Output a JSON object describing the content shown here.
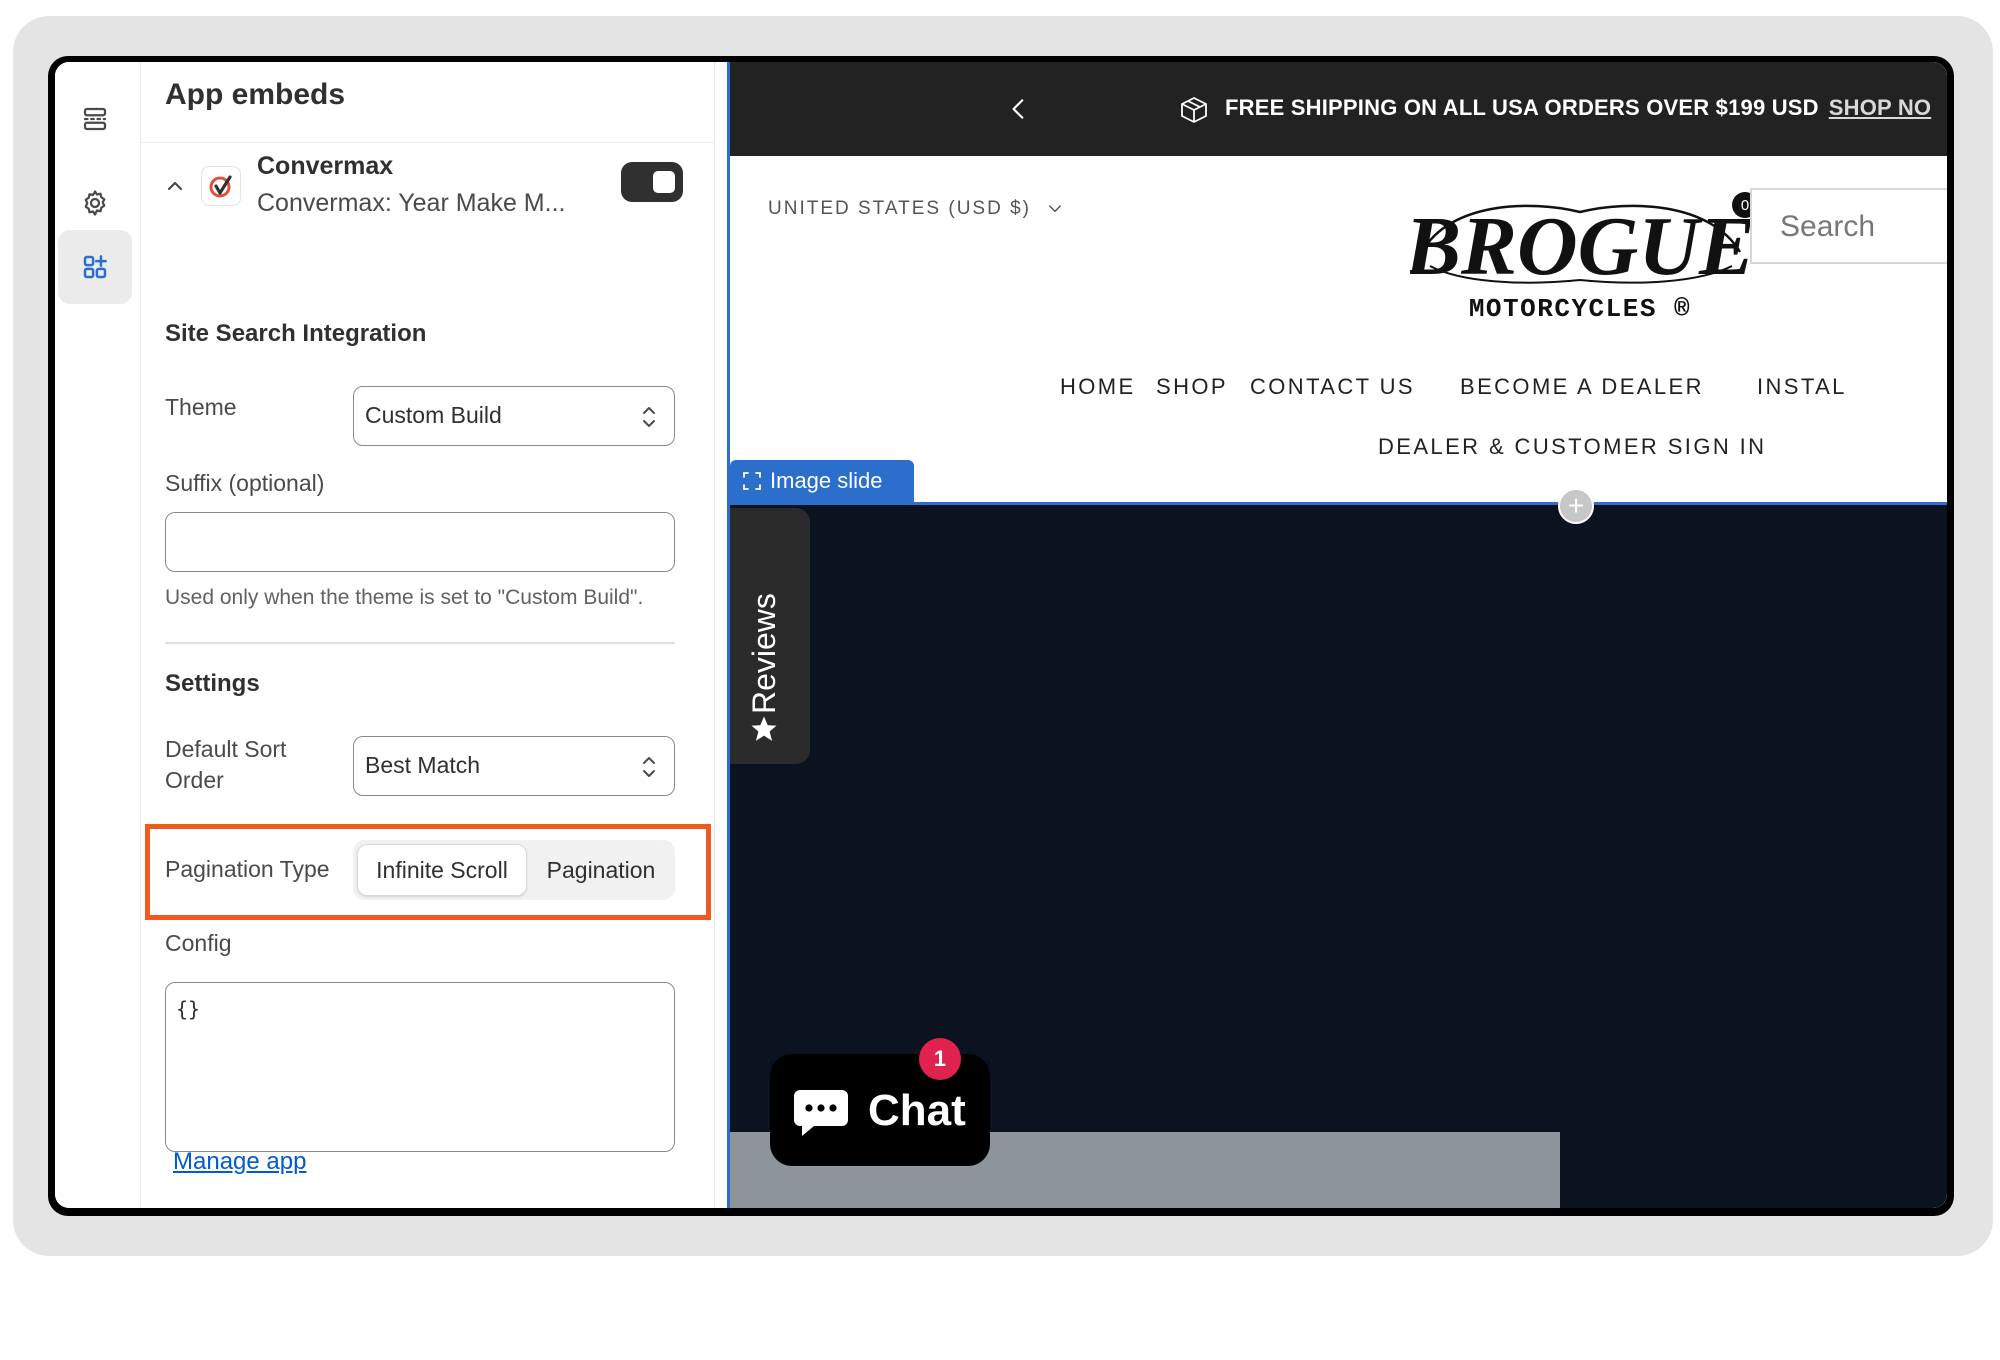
{
  "sidebar": {
    "title": "App embeds",
    "app": {
      "name": "Convermax",
      "subtitle": "Convermax: Year Make M...",
      "enabled": true
    },
    "site_search": {
      "heading": "Site Search Integration",
      "theme_label": "Theme",
      "theme_value": "Custom Build",
      "suffix_label": "Suffix (optional)",
      "suffix_value": "",
      "suffix_help": "Used only when the theme is set to \"Custom Build\"."
    },
    "settings": {
      "heading": "Settings",
      "sort_label_line1": "Default Sort",
      "sort_label_line2": "Order",
      "sort_value": "Best Match",
      "pagination_label": "Pagination Type",
      "pagination_options": [
        "Infinite Scroll",
        "Pagination"
      ],
      "pagination_selected": "Infinite Scroll",
      "config_label": "Config",
      "config_value": "{}",
      "manage_link": "Manage app"
    }
  },
  "preview": {
    "announcement": "FREE SHIPPING ON ALL USA ORDERS OVER $199 USD",
    "announcement_link": "SHOP NO",
    "country": "UNITED STATES (USD $)",
    "logo_main": "BROGUE",
    "logo_sub": "MOTORCYCLES ®",
    "cart_count": "0",
    "search_placeholder": "Search",
    "nav_items": [
      "HOME",
      "SHOP",
      "CONTACT US",
      "BECOME A DEALER",
      "INSTAL"
    ],
    "nav_row2": "DEALER & CUSTOMER SIGN IN",
    "section_tag": "Image slide",
    "reviews_label": "Reviews",
    "chat_label": "Chat",
    "chat_badge": "1"
  },
  "colors": {
    "accent_blue": "#2c6ecb",
    "highlight_orange": "#f2591e",
    "badge_red": "#e0234e",
    "link_blue": "#005bd3"
  }
}
